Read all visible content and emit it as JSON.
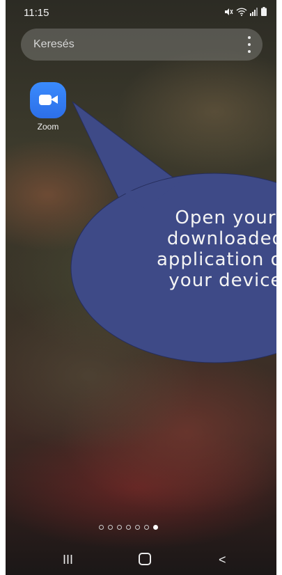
{
  "status_bar": {
    "time": "11:15",
    "icons": [
      "mute-icon",
      "wifi-icon",
      "signal-icon",
      "battery-icon"
    ]
  },
  "search": {
    "placeholder": "Keresés",
    "menu_icon": "more-vert-icon"
  },
  "apps": [
    {
      "label": "Zoom",
      "icon": "zoom-video-camera-icon",
      "color": "#2d8cff"
    }
  ],
  "callout": {
    "lines": [
      "Open your",
      "downloaded",
      "application on",
      "your device"
    ],
    "color": "#3e4a87"
  },
  "pager": {
    "total": 7,
    "active_index": 6
  },
  "nav": {
    "recent": "III",
    "back": "<"
  }
}
